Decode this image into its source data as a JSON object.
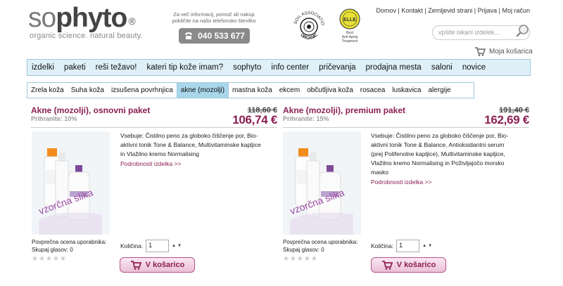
{
  "header": {
    "logo_so": "so",
    "logo_phyto": "phyto",
    "logo_reg": "®",
    "tagline": "organic science. natural beauty.",
    "contact_info": "Za več informacij, pomoč ali nakup pokličite na našo telefonsko številko",
    "phone": "040 533 677",
    "badge_soil_text": "SOIL ASSOCIATION",
    "badge_soil_center": "ORGANIC",
    "badge_ell_line1": "Best",
    "badge_ell_line2": "Anti Aging",
    "badge_ell_line3": "Treatment",
    "badge_ell_logo": "ELLE",
    "top_links": [
      "Domov",
      "Kontakt",
      "Zemljevid strani",
      "Prijava",
      "Moj račun"
    ],
    "search_placeholder": "vpšite iskani izdelek...",
    "cart_label": "Moja košarica"
  },
  "main_nav": [
    "izdelki",
    "paketi",
    "reši težavo!",
    "kateri tip kože imam?",
    "sophyto",
    "info center",
    "pričevanja",
    "prodajna mesta",
    "saloni",
    "novice"
  ],
  "sub_nav": {
    "items": [
      "Zrela koža",
      "Suha koža",
      "izsušena povrhnjica",
      "akne (mozolji)",
      "mastna koža",
      "ekcem",
      "občutljiva koža",
      "rosacea",
      "luskavica",
      "alergije"
    ],
    "active_index": 3
  },
  "products": [
    {
      "title": "Akne (mozolji), osnovni paket",
      "save": "Prihranite: 10%",
      "old_price": "118,60 €",
      "new_price": "106,74 €",
      "description": "Vsebuje: Čistilno peno za globoko čiščenje por, Bio-aktivni tonik Tone & Balance, Multivitaminske kapljice in Vlažilno kremo Normalising",
      "details_link": "Podrobnosti izdelka >>",
      "image_watermark": "vzorčna slika",
      "rating_label": "Povprečna ocena uporabnika:",
      "votes_label": "Skupaj glasov: 0",
      "rating": 0,
      "qty_label": "Količina:",
      "qty_value": "1",
      "cart_button": "V košarico"
    },
    {
      "title": "Akne (mozolji), premium paket",
      "save": "Prihranite: 15%",
      "old_price": "191,40 €",
      "new_price": "162,69 €",
      "description": "Vsebuje: Čistilno peno za globoko čiščenje por, Bio-aktivni tonik Tone & Balance, Antioksidantni serum (prej Polifenolne kapljice), Multivitaminske kapljice, Vlažilno kremo Normalising in Poživljajočo morsko masko",
      "details_link": "Podrobnosti izdelka >>",
      "image_watermark": "vzorčna slika",
      "rating_label": "Povprečna ocena uporabnika:",
      "votes_label": "Skupaj glasov: 0",
      "rating": 0,
      "qty_label": "Količina:",
      "qty_value": "1",
      "cart_button": "V košarico"
    }
  ],
  "colors": {
    "brand_purple": "#8b1f52",
    "nav_bg": "#dff0f8",
    "nav_border": "#9cc8dd",
    "active_tab": "#a9d6ea"
  }
}
